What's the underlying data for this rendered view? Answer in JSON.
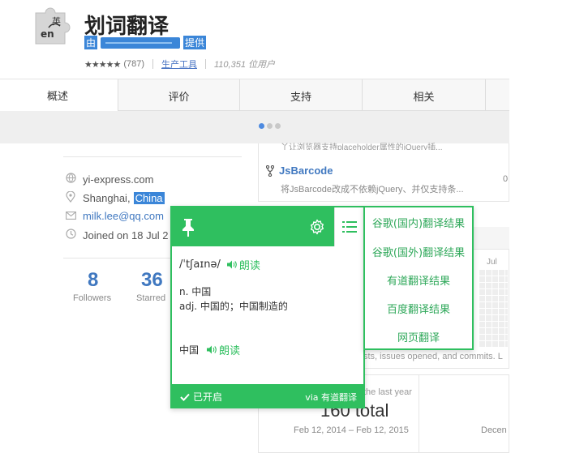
{
  "extension": {
    "title": "划词翻译",
    "by_prefix": "由",
    "by_suffix": "提供",
    "stars": "★★★★★",
    "rating_count": "(787)",
    "category": "生产工具",
    "users": "110,351 位用户",
    "icon_text_top": "英",
    "icon_text_bottom": "en"
  },
  "tabs": [
    "概述",
    "评价",
    "支持",
    "相关"
  ],
  "profile": {
    "website": "yi-express.com",
    "city": "Shanghai,",
    "country": "China",
    "email": "milk.lee@qq.com",
    "joined": "Joined on 18 Jul 2",
    "followers_count": "8",
    "followers_label": "Followers",
    "starred_count": "36",
    "starred_label": "Starred"
  },
  "repo": {
    "cut_text": "丫让浏览器支持placeholder属性的jQuery插...",
    "name": "JsBarcode",
    "desc": "将JsBarcode改成不依赖jQuery、并仅支持条...",
    "count": "0"
  },
  "contrib": {
    "month": "Jul",
    "note": "sts, issues opened, and commits. L",
    "year_label": "the last year",
    "total": "160 total",
    "range": "Feb 12, 2014 – Feb 12, 2015",
    "dec": "Decen"
  },
  "popup": {
    "phonetic": "/ˈtʃaɪnə/",
    "speak_label": "朗读",
    "def_noun": "n. 中国",
    "def_adj": "adj. 中国的；中国制造的",
    "translation": "中国",
    "enabled_label": "已开启",
    "via": "via 有道翻译"
  },
  "menu": [
    "谷歌(国内)翻译结果",
    "谷歌(国外)翻译结果",
    "有道翻译结果",
    "百度翻译结果",
    "网页翻译"
  ],
  "colors": {
    "accent": "#2fbf5f",
    "link": "#4078c0",
    "selection": "#3b86d8"
  }
}
